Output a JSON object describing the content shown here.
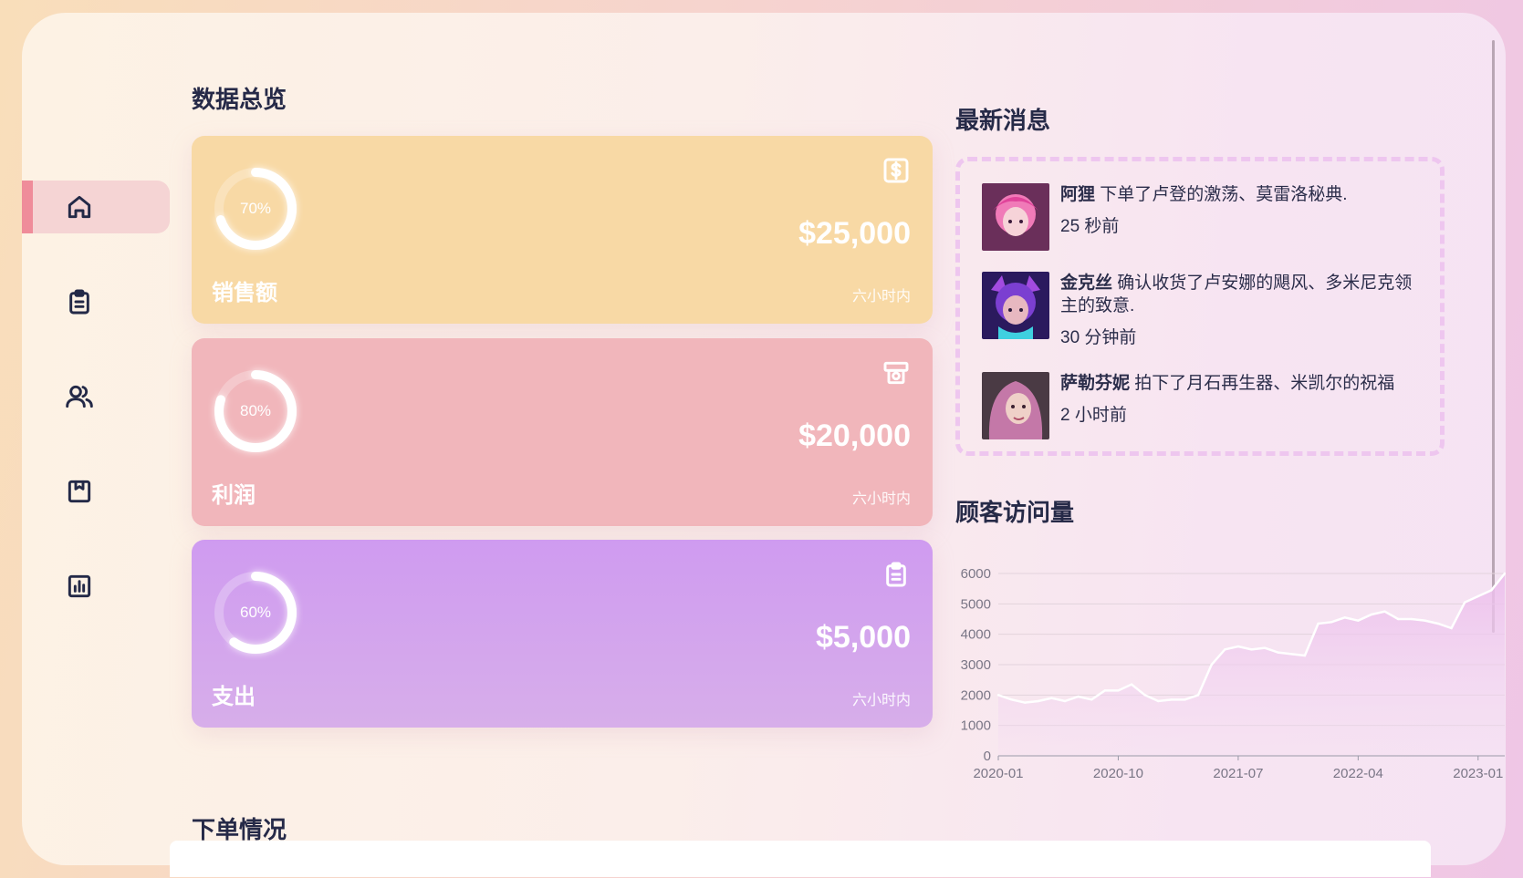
{
  "nav": {
    "items": [
      {
        "name": "home-icon",
        "active": true
      },
      {
        "name": "clipboard-icon",
        "active": false
      },
      {
        "name": "users-icon",
        "active": false
      },
      {
        "name": "bookmark-box-icon",
        "active": false
      },
      {
        "name": "bar-chart-icon",
        "active": false
      }
    ]
  },
  "overview": {
    "title": "数据总览",
    "cards": [
      {
        "label": "销售额",
        "amount": "$25,000",
        "percent_text": "70%",
        "percent": 70,
        "period": "六小时内",
        "icon": "dollar-icon",
        "color": "#f8d9a5"
      },
      {
        "label": "利润",
        "amount": "$20,000",
        "percent_text": "80%",
        "percent": 80,
        "period": "六小时内",
        "icon": "cash-register-icon",
        "color": "#f1b6bb"
      },
      {
        "label": "支出",
        "amount": "$5,000",
        "percent_text": "60%",
        "percent": 60,
        "period": "六小时内",
        "icon": "clipboard-icon",
        "color": "#d3a4ee"
      }
    ]
  },
  "messages": {
    "title": "最新消息",
    "items": [
      {
        "name": "阿狸",
        "text": "下单了卢登的激荡、莫雷洛秘典.",
        "time": "25 秒前"
      },
      {
        "name": "金克丝",
        "text": "确认收货了卢安娜的飓风、多米尼克领主的致意.",
        "time": "30 分钟前"
      },
      {
        "name": "萨勒芬妮",
        "text": "拍下了月石再生器、米凯尔的祝福",
        "time": "2 小时前"
      }
    ]
  },
  "visits": {
    "title": "顾客访问量"
  },
  "chart_data": {
    "type": "area",
    "title": "",
    "xlabel": "",
    "ylabel": "",
    "ylim": [
      0,
      6000
    ],
    "yticks": [
      "0",
      "1000",
      "2000",
      "3000",
      "4000",
      "5000",
      "6000"
    ],
    "xticks": [
      "2020-01",
      "2020-10",
      "2021-07",
      "2022-04",
      "2023-01"
    ],
    "grid": true,
    "x": [
      "2020-01",
      "2020-02",
      "2020-03",
      "2020-04",
      "2020-05",
      "2020-06",
      "2020-07",
      "2020-08",
      "2020-09",
      "2020-10",
      "2020-11",
      "2020-12",
      "2021-01",
      "2021-02",
      "2021-03",
      "2021-04",
      "2021-05",
      "2021-06",
      "2021-07",
      "2021-08",
      "2021-09",
      "2021-10",
      "2021-11",
      "2021-12",
      "2022-01",
      "2022-02",
      "2022-03",
      "2022-04",
      "2022-05",
      "2022-06",
      "2022-07",
      "2022-08",
      "2022-09",
      "2022-10",
      "2022-11",
      "2022-12",
      "2023-01",
      "2023-02",
      "2023-03"
    ],
    "values": [
      2000,
      1850,
      1750,
      1800,
      1900,
      1800,
      1950,
      1850,
      2150,
      2150,
      2350,
      2000,
      1800,
      1850,
      1850,
      2000,
      3000,
      3500,
      3600,
      3500,
      3550,
      3400,
      3350,
      3300,
      4350,
      4400,
      4550,
      4450,
      4650,
      4750,
      4500,
      4500,
      4450,
      4350,
      4200,
      5050,
      5250,
      5450,
      6000
    ],
    "colors": {
      "line": "#ffffff",
      "fill": "#eec9ee",
      "grid": "#e2d3dc",
      "axis": "#9a9aa8"
    }
  },
  "orders": {
    "title": "下单情况"
  }
}
